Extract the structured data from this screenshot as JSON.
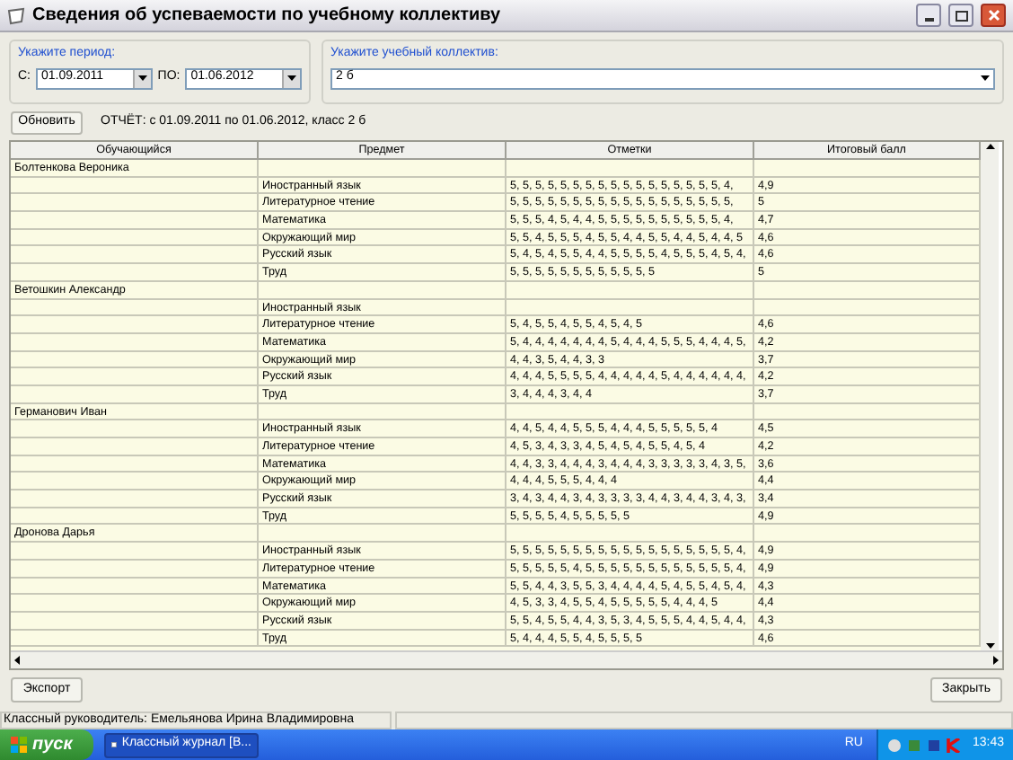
{
  "window": {
    "title": "Сведения об успеваемости по учебному коллективу"
  },
  "period": {
    "legend": "Укажите период:",
    "from_label": "С:",
    "from_value": "01.09.2011",
    "to_label": "ПО:",
    "to_value": "01.06.2012"
  },
  "group": {
    "legend": "Укажите учебный коллектив:",
    "value": "2 б"
  },
  "refresh_button": "Обновить",
  "report_text": "ОТЧЁТ: с 01.09.2011 по 01.06.2012, класс 2 б",
  "table": {
    "columns": [
      "Обучающийся",
      "Предмет",
      "Отметки",
      "Итоговый балл"
    ],
    "students": [
      {
        "name": "Болтенкова Вероника",
        "subjects": [
          {
            "subject": "Иностранный язык",
            "marks": "5, 5, 5, 5, 5, 5, 5, 5, 5, 5, 5, 5, 5, 5, 5, 5, 5, 4,",
            "total": "4,9"
          },
          {
            "subject": "Литературное чтение",
            "marks": "5, 5, 5, 5, 5, 5, 5, 5, 5, 5, 5, 5, 5, 5, 5, 5, 5, 5,",
            "total": "5"
          },
          {
            "subject": "Математика",
            "marks": "5, 5, 5, 4, 5, 4, 4, 5, 5, 5, 5, 5, 5, 5, 5, 5, 5, 4,",
            "total": "4,7"
          },
          {
            "subject": "Окружающий мир",
            "marks": "5, 5, 4, 5, 5, 5, 4, 5, 5, 4, 4, 5, 5, 4, 4, 5, 4, 4, 5",
            "total": "4,6"
          },
          {
            "subject": "Русский язык",
            "marks": "5, 4, 5, 4, 5, 5, 4, 4, 5, 5, 5, 5, 4, 5, 5, 5, 4, 5, 4,",
            "total": "4,6"
          },
          {
            "subject": "Труд",
            "marks": "5, 5, 5, 5, 5, 5, 5, 5, 5, 5, 5, 5",
            "total": "5"
          }
        ]
      },
      {
        "name": "Ветошкин Александр",
        "subjects": [
          {
            "subject": "Иностранный язык"
          },
          {
            "subject": "Литературное чтение",
            "marks": "5, 4, 5, 5, 4, 5, 5, 4, 5, 4, 5",
            "total": "4,6"
          },
          {
            "subject": "Математика",
            "marks": "5, 4, 4, 4, 4, 4, 4, 4, 5, 4, 4, 4, 5, 5, 5, 4, 4, 4, 5,",
            "total": "4,2"
          },
          {
            "subject": "Окружающий мир",
            "marks": "4, 4, 3, 5, 4, 4, 3, 3",
            "total": "3,7"
          },
          {
            "subject": "Русский язык",
            "marks": "4, 4, 4, 5, 5, 5, 5, 4, 4, 4, 4, 4, 5, 4, 4, 4, 4, 4, 4,",
            "total": "4,2"
          },
          {
            "subject": "Труд",
            "marks": "3, 4, 4, 4, 3, 4, 4",
            "total": "3,7"
          }
        ]
      },
      {
        "name": "Германович Иван",
        "subjects": [
          {
            "subject": "Иностранный язык",
            "marks": "4, 4, 5, 4, 4, 5, 5, 5, 4, 4, 4, 5, 5, 5, 5, 5, 4",
            "total": "4,5"
          },
          {
            "subject": "Литературное чтение",
            "marks": "4, 5, 3, 4, 3, 3, 4, 5, 4, 5, 4, 5, 5, 4, 5, 4",
            "total": "4,2"
          },
          {
            "subject": "Математика",
            "marks": "4, 4, 3, 3, 4, 4, 4, 3, 4, 4, 4, 3, 3, 3, 3, 3, 4, 3, 5,",
            "total": "3,6"
          },
          {
            "subject": "Окружающий мир",
            "marks": "4, 4, 4, 5, 5, 5, 4, 4, 4",
            "total": "4,4"
          },
          {
            "subject": "Русский язык",
            "marks": "3, 4, 3, 4, 4, 3, 4, 3, 3, 3, 3, 4, 4, 3, 4, 4, 3, 4, 3,",
            "total": "3,4"
          },
          {
            "subject": "Труд",
            "marks": "5, 5, 5, 5, 4, 5, 5, 5, 5, 5",
            "total": "4,9"
          }
        ]
      },
      {
        "name": "Дронова Дарья",
        "subjects": [
          {
            "subject": "Иностранный язык",
            "marks": "5, 5, 5, 5, 5, 5, 5, 5, 5, 5, 5, 5, 5, 5, 5, 5, 5, 5, 4,",
            "total": "4,9"
          },
          {
            "subject": "Литературное чтение",
            "marks": "5, 5, 5, 5, 5, 4, 5, 5, 5, 5, 5, 5, 5, 5, 5, 5, 5, 5, 4,",
            "total": "4,9"
          },
          {
            "subject": "Математика",
            "marks": "5, 5, 4, 4, 3, 5, 5, 3, 4, 4, 4, 4, 5, 4, 5, 5, 4, 5, 4,",
            "total": "4,3"
          },
          {
            "subject": "Окружающий мир",
            "marks": "4, 5, 3, 3, 4, 5, 5, 4, 5, 5, 5, 5, 5, 4, 4, 4, 5",
            "total": "4,4"
          },
          {
            "subject": "Русский язык",
            "marks": "5, 5, 4, 5, 5, 4, 4, 3, 5, 3, 4, 5, 5, 5, 4, 4, 5, 4, 4,",
            "total": "4,3"
          },
          {
            "subject": "Труд",
            "marks": "5, 4, 4, 4, 5, 5, 4, 5, 5, 5, 5",
            "total": "4,6"
          }
        ]
      }
    ]
  },
  "export_button": "Экспорт",
  "close_button": "Закрыть",
  "status_bar": "Классный руководитель: Емельянова  Ирина  Владимировна",
  "taskbar": {
    "start": "пуск",
    "task": "Классный журнал [B...",
    "lang": "RU",
    "clock": "13:43"
  }
}
